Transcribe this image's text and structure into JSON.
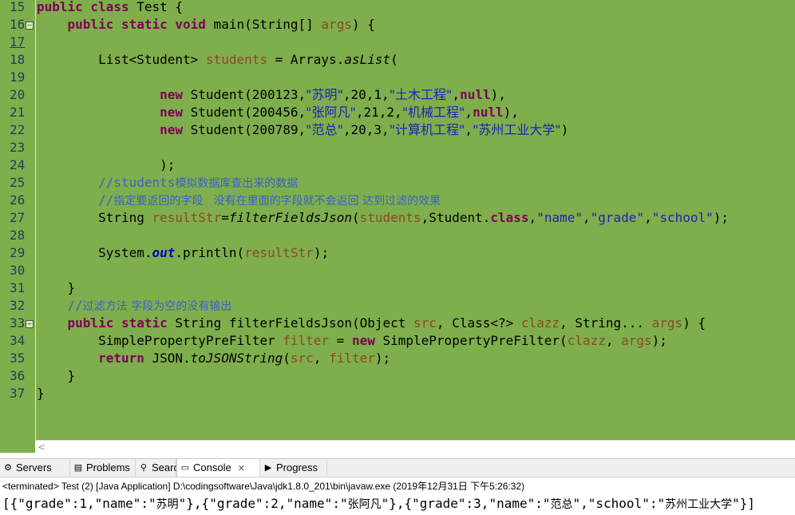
{
  "editor": {
    "lines": [
      {
        "n": "15",
        "fold": false,
        "cur": false,
        "tokens": [
          {
            "t": "kw",
            "v": "public class"
          },
          {
            "t": "p",
            "v": " Test {"
          }
        ]
      },
      {
        "n": "16",
        "fold": true,
        "cur": false,
        "tokens": [
          {
            "t": "p",
            "v": "    "
          },
          {
            "t": "kw",
            "v": "public static void"
          },
          {
            "t": "p",
            "v": " main(String[] "
          },
          {
            "t": "var",
            "v": "args"
          },
          {
            "t": "p",
            "v": ") {"
          }
        ]
      },
      {
        "n": "17",
        "fold": false,
        "cur": true,
        "tokens": []
      },
      {
        "n": "18",
        "fold": false,
        "cur": false,
        "tokens": [
          {
            "t": "p",
            "v": "        List<Student> "
          },
          {
            "t": "var",
            "v": "students"
          },
          {
            "t": "p",
            "v": " = Arrays."
          },
          {
            "t": "it",
            "v": "asList"
          },
          {
            "t": "p",
            "v": "("
          }
        ]
      },
      {
        "n": "19",
        "fold": false,
        "cur": false,
        "tokens": []
      },
      {
        "n": "20",
        "fold": false,
        "cur": false,
        "tokens": [
          {
            "t": "p",
            "v": "                "
          },
          {
            "t": "kw",
            "v": "new"
          },
          {
            "t": "p",
            "v": " Student(200123,"
          },
          {
            "t": "strc",
            "v": "\"苏明\""
          },
          {
            "t": "p",
            "v": ",20,1,"
          },
          {
            "t": "strc",
            "v": "\"土木工程\""
          },
          {
            "t": "p",
            "v": ","
          },
          {
            "t": "kw",
            "v": "null"
          },
          {
            "t": "p",
            "v": "),"
          }
        ]
      },
      {
        "n": "21",
        "fold": false,
        "cur": false,
        "tokens": [
          {
            "t": "p",
            "v": "                "
          },
          {
            "t": "kw",
            "v": "new"
          },
          {
            "t": "p",
            "v": " Student(200456,"
          },
          {
            "t": "strc",
            "v": "\"张阿凡\""
          },
          {
            "t": "p",
            "v": ",21,2,"
          },
          {
            "t": "strc",
            "v": "\"机械工程\""
          },
          {
            "t": "p",
            "v": ","
          },
          {
            "t": "kw",
            "v": "null"
          },
          {
            "t": "p",
            "v": "),"
          }
        ]
      },
      {
        "n": "22",
        "fold": false,
        "cur": false,
        "tokens": [
          {
            "t": "p",
            "v": "                "
          },
          {
            "t": "kw",
            "v": "new"
          },
          {
            "t": "p",
            "v": " Student(200789,"
          },
          {
            "t": "strc",
            "v": "\"范总\""
          },
          {
            "t": "p",
            "v": ",20,3,"
          },
          {
            "t": "strc",
            "v": "\"计算机工程\""
          },
          {
            "t": "p",
            "v": ","
          },
          {
            "t": "strc",
            "v": "\"苏州工业大学\""
          },
          {
            "t": "p",
            "v": ")"
          }
        ]
      },
      {
        "n": "23",
        "fold": false,
        "cur": false,
        "tokens": []
      },
      {
        "n": "24",
        "fold": false,
        "cur": false,
        "tokens": [
          {
            "t": "p",
            "v": "                );"
          }
        ]
      },
      {
        "n": "25",
        "fold": false,
        "cur": false,
        "tokens": [
          {
            "t": "p",
            "v": "        "
          },
          {
            "t": "cmt",
            "v": "//students"
          },
          {
            "t": "cmtc",
            "v": "模拟数据库查出来的数据"
          }
        ]
      },
      {
        "n": "26",
        "fold": false,
        "cur": false,
        "tokens": [
          {
            "t": "p",
            "v": "        "
          },
          {
            "t": "cmt",
            "v": "//"
          },
          {
            "t": "cmtc",
            "v": "指定要返回的字段   没有在里面的字段就不会返回 达到过滤的效果"
          }
        ]
      },
      {
        "n": "27",
        "fold": false,
        "cur": false,
        "tokens": [
          {
            "t": "p",
            "v": "        String "
          },
          {
            "t": "var",
            "v": "resultStr"
          },
          {
            "t": "p",
            "v": "="
          },
          {
            "t": "it",
            "v": "filterFieldsJson"
          },
          {
            "t": "p",
            "v": "("
          },
          {
            "t": "var",
            "v": "students"
          },
          {
            "t": "p",
            "v": ",Student."
          },
          {
            "t": "kw",
            "v": "class"
          },
          {
            "t": "p",
            "v": ","
          },
          {
            "t": "str",
            "v": "\"name\""
          },
          {
            "t": "p",
            "v": ","
          },
          {
            "t": "str",
            "v": "\"grade\""
          },
          {
            "t": "p",
            "v": ","
          },
          {
            "t": "str",
            "v": "\"school\""
          },
          {
            "t": "p",
            "v": ");"
          }
        ]
      },
      {
        "n": "28",
        "fold": false,
        "cur": false,
        "tokens": []
      },
      {
        "n": "29",
        "fold": false,
        "cur": false,
        "tokens": [
          {
            "t": "p",
            "v": "        System."
          },
          {
            "t": "fld",
            "v": "out"
          },
          {
            "t": "p",
            "v": ".println("
          },
          {
            "t": "var",
            "v": "resultStr"
          },
          {
            "t": "p",
            "v": ");"
          }
        ]
      },
      {
        "n": "30",
        "fold": false,
        "cur": false,
        "tokens": []
      },
      {
        "n": "31",
        "fold": false,
        "cur": false,
        "tokens": [
          {
            "t": "p",
            "v": "    }"
          }
        ]
      },
      {
        "n": "32",
        "fold": false,
        "cur": false,
        "tokens": [
          {
            "t": "p",
            "v": "    "
          },
          {
            "t": "cmt",
            "v": "//"
          },
          {
            "t": "cmtc",
            "v": "过滤方法 字段为空的没有输出"
          }
        ]
      },
      {
        "n": "33",
        "fold": true,
        "cur": false,
        "tokens": [
          {
            "t": "p",
            "v": "    "
          },
          {
            "t": "kw",
            "v": "public static"
          },
          {
            "t": "p",
            "v": " String filterFieldsJson(Object "
          },
          {
            "t": "var",
            "v": "src"
          },
          {
            "t": "p",
            "v": ", Class<?> "
          },
          {
            "t": "var",
            "v": "clazz"
          },
          {
            "t": "p",
            "v": ", String... "
          },
          {
            "t": "var",
            "v": "args"
          },
          {
            "t": "p",
            "v": ") {"
          }
        ]
      },
      {
        "n": "34",
        "fold": false,
        "cur": false,
        "tokens": [
          {
            "t": "p",
            "v": "        SimplePropertyPreFilter "
          },
          {
            "t": "var",
            "v": "filter"
          },
          {
            "t": "p",
            "v": " = "
          },
          {
            "t": "kw",
            "v": "new"
          },
          {
            "t": "p",
            "v": " SimplePropertyPreFilter("
          },
          {
            "t": "var",
            "v": "clazz"
          },
          {
            "t": "p",
            "v": ", "
          },
          {
            "t": "var",
            "v": "args"
          },
          {
            "t": "p",
            "v": ");"
          }
        ]
      },
      {
        "n": "35",
        "fold": false,
        "cur": false,
        "tokens": [
          {
            "t": "p",
            "v": "        "
          },
          {
            "t": "kw",
            "v": "return"
          },
          {
            "t": "p",
            "v": " JSON."
          },
          {
            "t": "it",
            "v": "toJSONString"
          },
          {
            "t": "p",
            "v": "("
          },
          {
            "t": "var",
            "v": "src"
          },
          {
            "t": "p",
            "v": ", "
          },
          {
            "t": "var",
            "v": "filter"
          },
          {
            "t": "p",
            "v": ");"
          }
        ]
      },
      {
        "n": "36",
        "fold": false,
        "cur": false,
        "tokens": [
          {
            "t": "p",
            "v": "    }"
          }
        ]
      },
      {
        "n": "37",
        "fold": false,
        "cur": false,
        "tokens": [
          {
            "t": "p",
            "v": "}"
          }
        ]
      }
    ],
    "scroll_left_glyph": "<"
  },
  "panel": {
    "tabs": [
      {
        "id": "servers",
        "label": "Servers",
        "icon": "servers-icon",
        "glyph": "⚙",
        "active": false
      },
      {
        "id": "problems",
        "label": "Problems",
        "icon": "problems-icon",
        "glyph": "▤",
        "active": false
      },
      {
        "id": "search",
        "label": "Search",
        "icon": "search-icon",
        "glyph": "⚲",
        "active": false
      },
      {
        "id": "console",
        "label": "Console",
        "icon": "console-icon",
        "glyph": "▭",
        "active": true,
        "close": "✕"
      },
      {
        "id": "progress",
        "label": "Progress",
        "icon": "progress-icon",
        "glyph": "▶",
        "active": false
      }
    ],
    "status": "<terminated> Test (2) [Java Application] D:\\codingsoftware\\Java\\jdk1.8.0_201\\bin\\javaw.exe (2019年12月31日 下午5:26:32)",
    "output": "[{\"grade\":1,\"name\":\"苏明\"},{\"grade\":2,\"name\":\"张阿凡\"},{\"grade\":3,\"name\":\"范总\",\"school\":\"苏州工业大学\"}]"
  },
  "colors": {
    "editor_bg": "#7fae4c",
    "keyword": "#7f0055",
    "string": "#1f1fb8",
    "variable": "#8a4a23",
    "comment": "#3c62c4",
    "field": "#0000c0"
  }
}
